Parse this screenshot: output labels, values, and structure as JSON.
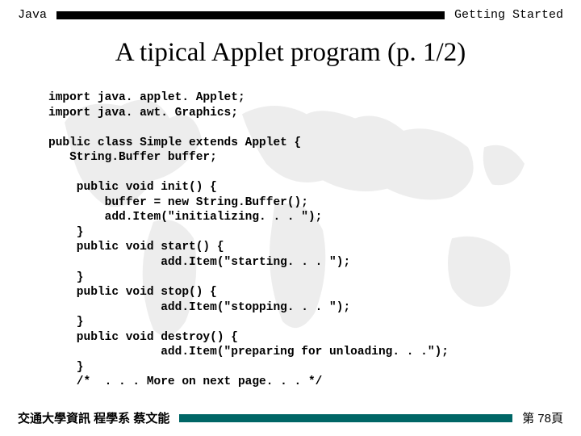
{
  "header": {
    "left": "Java",
    "right": "Getting Started"
  },
  "title": "A tipical Applet program  (p. 1/2)",
  "code": "import java. applet. Applet;\nimport java. awt. Graphics;\n\npublic class Simple extends Applet {\n   String.Buffer buffer;\n\n    public void init() {\n        buffer = new String.Buffer();\n        add.Item(\"initializing. . . \");\n    }\n    public void start() {\n                add.Item(\"starting. . . \");\n    }\n    public void stop() {\n                add.Item(\"stopping. . . \");\n    }\n    public void destroy() {\n                add.Item(\"preparing for unloading. . .\");\n    }\n    /*  . . . More on next page. . . */",
  "footer": {
    "left": "交通大學資訊 程學系 蔡文能",
    "right": "第 78頁"
  }
}
